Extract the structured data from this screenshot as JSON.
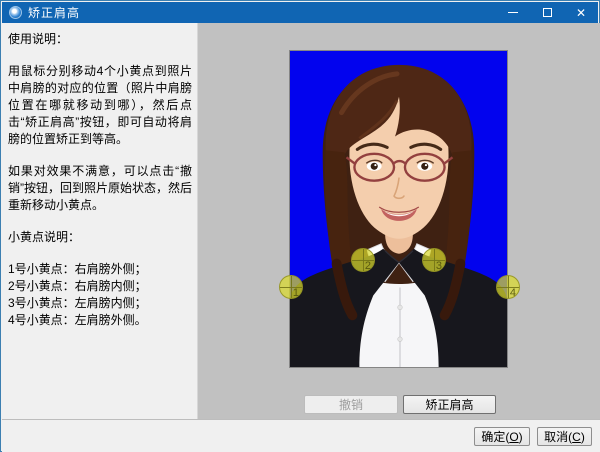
{
  "window": {
    "title": "矫正肩高",
    "close_glyph": "✕"
  },
  "panel": {
    "usage_title": "使用说明：",
    "usage_para1": "用鼠标分别移动4个小黄点到照片中肩膀的对应的位置（照片中肩膀位置在哪就移动到哪），然后点击“矫正肩高”按钮，即可自动将肩膀的位置矫正到等高。",
    "usage_para2": "如果对效果不满意，可以点击“撤销”按钮，回到照片原始状态，然后重新移动小黄点。",
    "dots_title": "小黄点说明：",
    "dot_lines": [
      "1号小黄点：右肩膀外侧；",
      "2号小黄点：右肩膀内侧；",
      "3号小黄点：左肩膀内侧；",
      "4号小黄点：左肩膀外侧。"
    ]
  },
  "photo": {
    "background_color": "#0203ee",
    "dots": [
      {
        "label": "1"
      },
      {
        "label": "2"
      },
      {
        "label": "3"
      },
      {
        "label": "4"
      }
    ]
  },
  "actions": {
    "undo": "撤销",
    "correct": "矫正肩高"
  },
  "footer": {
    "ok_pre": "确定(",
    "ok_key": "O",
    "ok_suf": ")",
    "cancel_pre": "取消(",
    "cancel_key": "C",
    "cancel_suf": ")"
  },
  "colors": {
    "titlebar": "#1065b3",
    "left_panel": "#f0f0f0",
    "right_panel": "#c1c1c1",
    "dot_fill": "#d9d92d",
    "photo_blue": "#0203ee"
  }
}
